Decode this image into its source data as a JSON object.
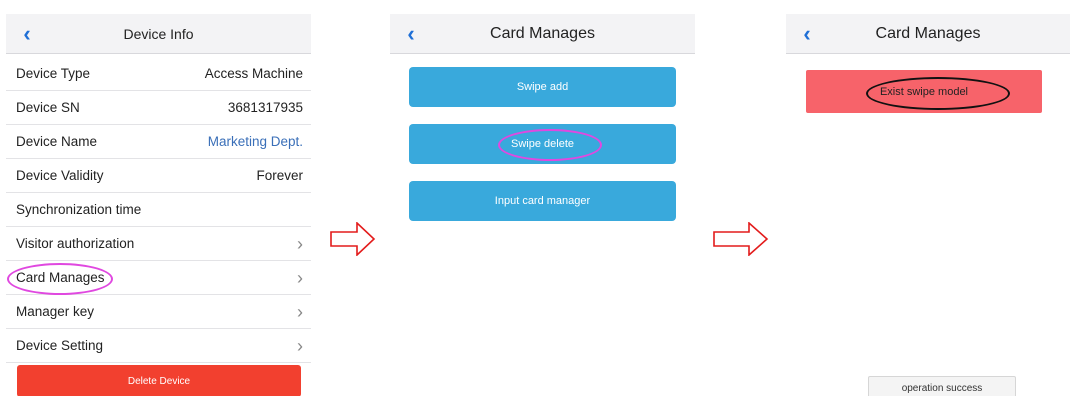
{
  "device_info": {
    "title": "Device Info",
    "rows": [
      {
        "label": "Device Type",
        "value": "Access Machine"
      },
      {
        "label": "Device SN",
        "value": "3681317935"
      },
      {
        "label": "Device Name",
        "value": "Marketing Dept."
      },
      {
        "label": "Device Validity",
        "value": "Forever"
      },
      {
        "label": "Synchronization time",
        "value": ""
      },
      {
        "label": "Visitor authorization",
        "value": ""
      },
      {
        "label": "Card Manages",
        "value": ""
      },
      {
        "label": "Manager key",
        "value": ""
      },
      {
        "label": "Device Setting",
        "value": ""
      }
    ],
    "delete_label": "Delete Device"
  },
  "card_manages": {
    "title": "Card Manages",
    "buttons": [
      "Swipe add",
      "Swipe delete",
      "Input card manager"
    ]
  },
  "result": {
    "title": "Card Manages",
    "alert": "Exist swipe model",
    "toast": "operation success"
  },
  "colors": {
    "nav_back": "#1f6fd6",
    "link": "#3a6fb8",
    "delete_red": "#f2402f",
    "action_blue": "#39a9dc",
    "alert_red": "#f7636a",
    "highlight_magenta": "#e048e0",
    "flow_arrow": "#e31b1b"
  },
  "icons": {
    "back": "chevron-left-icon",
    "row_nav": "chevron-right-icon",
    "flow": "right-arrow-icon"
  }
}
